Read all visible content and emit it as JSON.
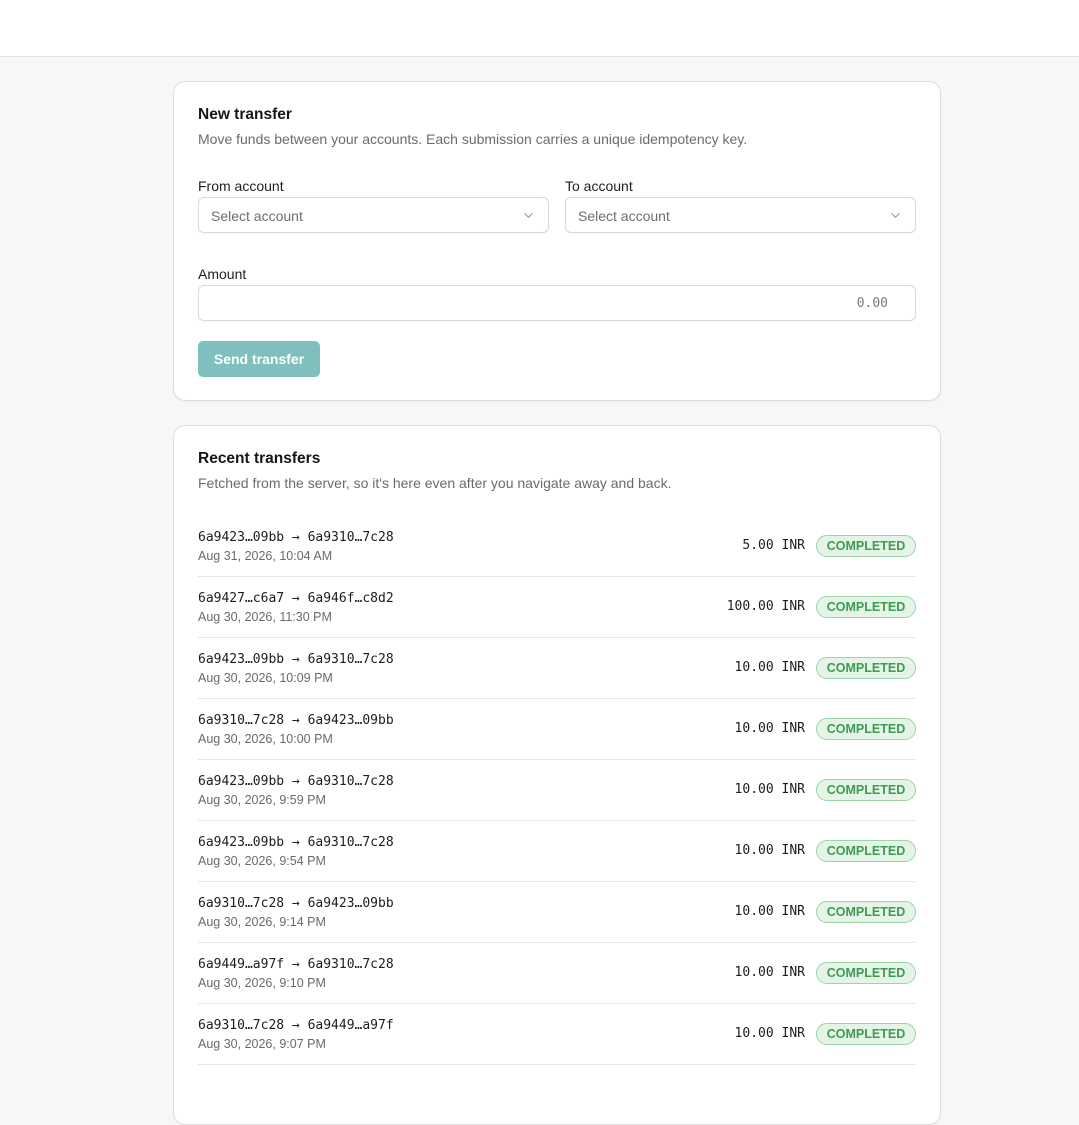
{
  "transfer_form": {
    "title": "New transfer",
    "subtitle": "Move funds between your accounts. Each submission carries a unique idempotency key.",
    "from_label": "From account",
    "from_placeholder": "Select account",
    "to_label": "To account",
    "to_placeholder": "Select account",
    "amount_label": "Amount",
    "amount_placeholder": "0.00",
    "submit_label": "Send transfer"
  },
  "recent": {
    "title": "Recent transfers",
    "subtitle": "Fetched from the server, so it's here even after you navigate away and back.",
    "items": [
      {
        "route": "6a9423…09bb → 6a9310…7c28",
        "timestamp": "Aug 31, 2026, 10:04 AM",
        "amount": "5.00 INR",
        "status": "COMPLETED"
      },
      {
        "route": "6a9427…c6a7 → 6a946f…c8d2",
        "timestamp": "Aug 30, 2026, 11:30 PM",
        "amount": "100.00 INR",
        "status": "COMPLETED"
      },
      {
        "route": "6a9423…09bb → 6a9310…7c28",
        "timestamp": "Aug 30, 2026, 10:09 PM",
        "amount": "10.00 INR",
        "status": "COMPLETED"
      },
      {
        "route": "6a9310…7c28 → 6a9423…09bb",
        "timestamp": "Aug 30, 2026, 10:00 PM",
        "amount": "10.00 INR",
        "status": "COMPLETED"
      },
      {
        "route": "6a9423…09bb → 6a9310…7c28",
        "timestamp": "Aug 30, 2026, 9:59 PM",
        "amount": "10.00 INR",
        "status": "COMPLETED"
      },
      {
        "route": "6a9423…09bb → 6a9310…7c28",
        "timestamp": "Aug 30, 2026, 9:54 PM",
        "amount": "10.00 INR",
        "status": "COMPLETED"
      },
      {
        "route": "6a9310…7c28 → 6a9423…09bb",
        "timestamp": "Aug 30, 2026, 9:14 PM",
        "amount": "10.00 INR",
        "status": "COMPLETED"
      },
      {
        "route": "6a9449…a97f → 6a9310…7c28",
        "timestamp": "Aug 30, 2026, 9:10 PM",
        "amount": "10.00 INR",
        "status": "COMPLETED"
      },
      {
        "route": "6a9310…7c28 → 6a9449…a97f",
        "timestamp": "Aug 30, 2026, 9:07 PM",
        "amount": "10.00 INR",
        "status": "COMPLETED"
      }
    ]
  },
  "colors": {
    "accent_button": "#7fc0bd",
    "status_completed_text": "#3f9a52",
    "status_completed_bg": "#e4f4e7",
    "status_completed_border": "#9ed3a8",
    "page_bg": "#f7f7f5"
  },
  "icons": {
    "select_chevron": "chevron-down-icon"
  }
}
